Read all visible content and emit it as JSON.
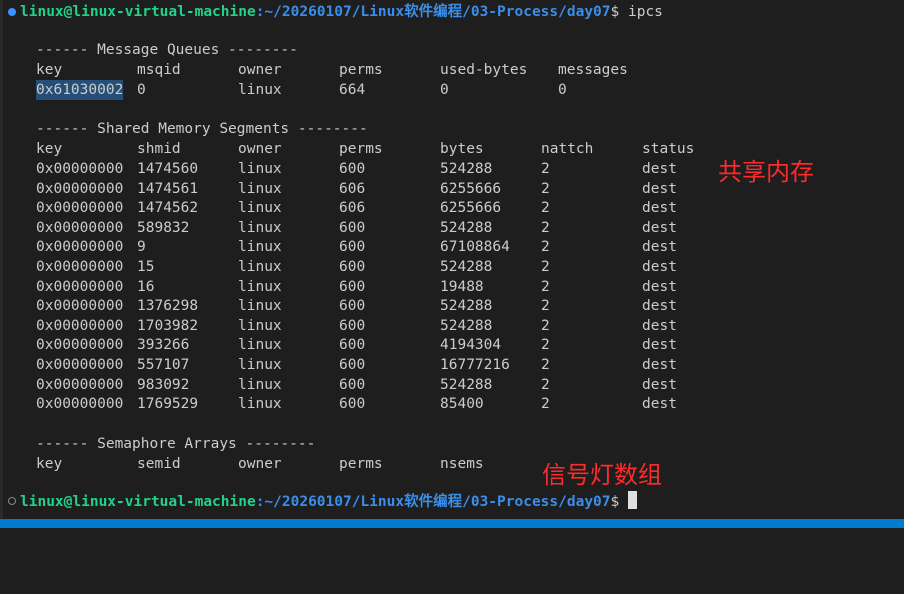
{
  "prompt": {
    "user_host": "linux@linux-virtual-machine",
    "path": ":~/20260107/Linux软件编程/03-Process/day07",
    "symbol": "$",
    "command": "ipcs"
  },
  "mq": {
    "header": "------ Message Queues --------",
    "columns": [
      "key",
      "msqid",
      "owner",
      "perms",
      "used-bytes",
      "messages"
    ],
    "rows": [
      {
        "key": "0x61030002",
        "id": "0",
        "owner": "linux",
        "perms": "664",
        "bytes": "0",
        "extra": "0"
      }
    ]
  },
  "shm": {
    "header": "------ Shared Memory Segments --------",
    "columns": [
      "key",
      "shmid",
      "owner",
      "perms",
      "bytes",
      "nattch",
      "status"
    ],
    "rows": [
      {
        "key": "0x00000000",
        "id": "1474560",
        "owner": "linux",
        "perms": "600",
        "bytes": "524288",
        "nattch": "2",
        "status": "dest"
      },
      {
        "key": "0x00000000",
        "id": "1474561",
        "owner": "linux",
        "perms": "606",
        "bytes": "6255666",
        "nattch": "2",
        "status": "dest"
      },
      {
        "key": "0x00000000",
        "id": "1474562",
        "owner": "linux",
        "perms": "606",
        "bytes": "6255666",
        "nattch": "2",
        "status": "dest"
      },
      {
        "key": "0x00000000",
        "id": "589832",
        "owner": "linux",
        "perms": "600",
        "bytes": "524288",
        "nattch": "2",
        "status": "dest"
      },
      {
        "key": "0x00000000",
        "id": "9",
        "owner": "linux",
        "perms": "600",
        "bytes": "67108864",
        "nattch": "2",
        "status": "dest"
      },
      {
        "key": "0x00000000",
        "id": "15",
        "owner": "linux",
        "perms": "600",
        "bytes": "524288",
        "nattch": "2",
        "status": "dest"
      },
      {
        "key": "0x00000000",
        "id": "16",
        "owner": "linux",
        "perms": "600",
        "bytes": "19488",
        "nattch": "2",
        "status": "dest"
      },
      {
        "key": "0x00000000",
        "id": "1376298",
        "owner": "linux",
        "perms": "600",
        "bytes": "524288",
        "nattch": "2",
        "status": "dest"
      },
      {
        "key": "0x00000000",
        "id": "1703982",
        "owner": "linux",
        "perms": "600",
        "bytes": "524288",
        "nattch": "2",
        "status": "dest"
      },
      {
        "key": "0x00000000",
        "id": "393266",
        "owner": "linux",
        "perms": "600",
        "bytes": "4194304",
        "nattch": "2",
        "status": "dest"
      },
      {
        "key": "0x00000000",
        "id": "557107",
        "owner": "linux",
        "perms": "600",
        "bytes": "16777216",
        "nattch": "2",
        "status": "dest"
      },
      {
        "key": "0x00000000",
        "id": "983092",
        "owner": "linux",
        "perms": "600",
        "bytes": "524288",
        "nattch": "2",
        "status": "dest"
      },
      {
        "key": "0x00000000",
        "id": "1769529",
        "owner": "linux",
        "perms": "600",
        "bytes": "85400",
        "nattch": "2",
        "status": "dest"
      }
    ]
  },
  "sem": {
    "header": "------ Semaphore Arrays --------",
    "columns": [
      "key",
      "semid",
      "owner",
      "perms",
      "nsems"
    ]
  },
  "annotations": {
    "shared_memory": "共享内存",
    "semaphore": "信号灯数组"
  },
  "colors": {
    "annotation": "#ff2a2a",
    "prompt_user": "#23d18b",
    "prompt_path": "#3b8eea",
    "selection": "#264f78"
  }
}
